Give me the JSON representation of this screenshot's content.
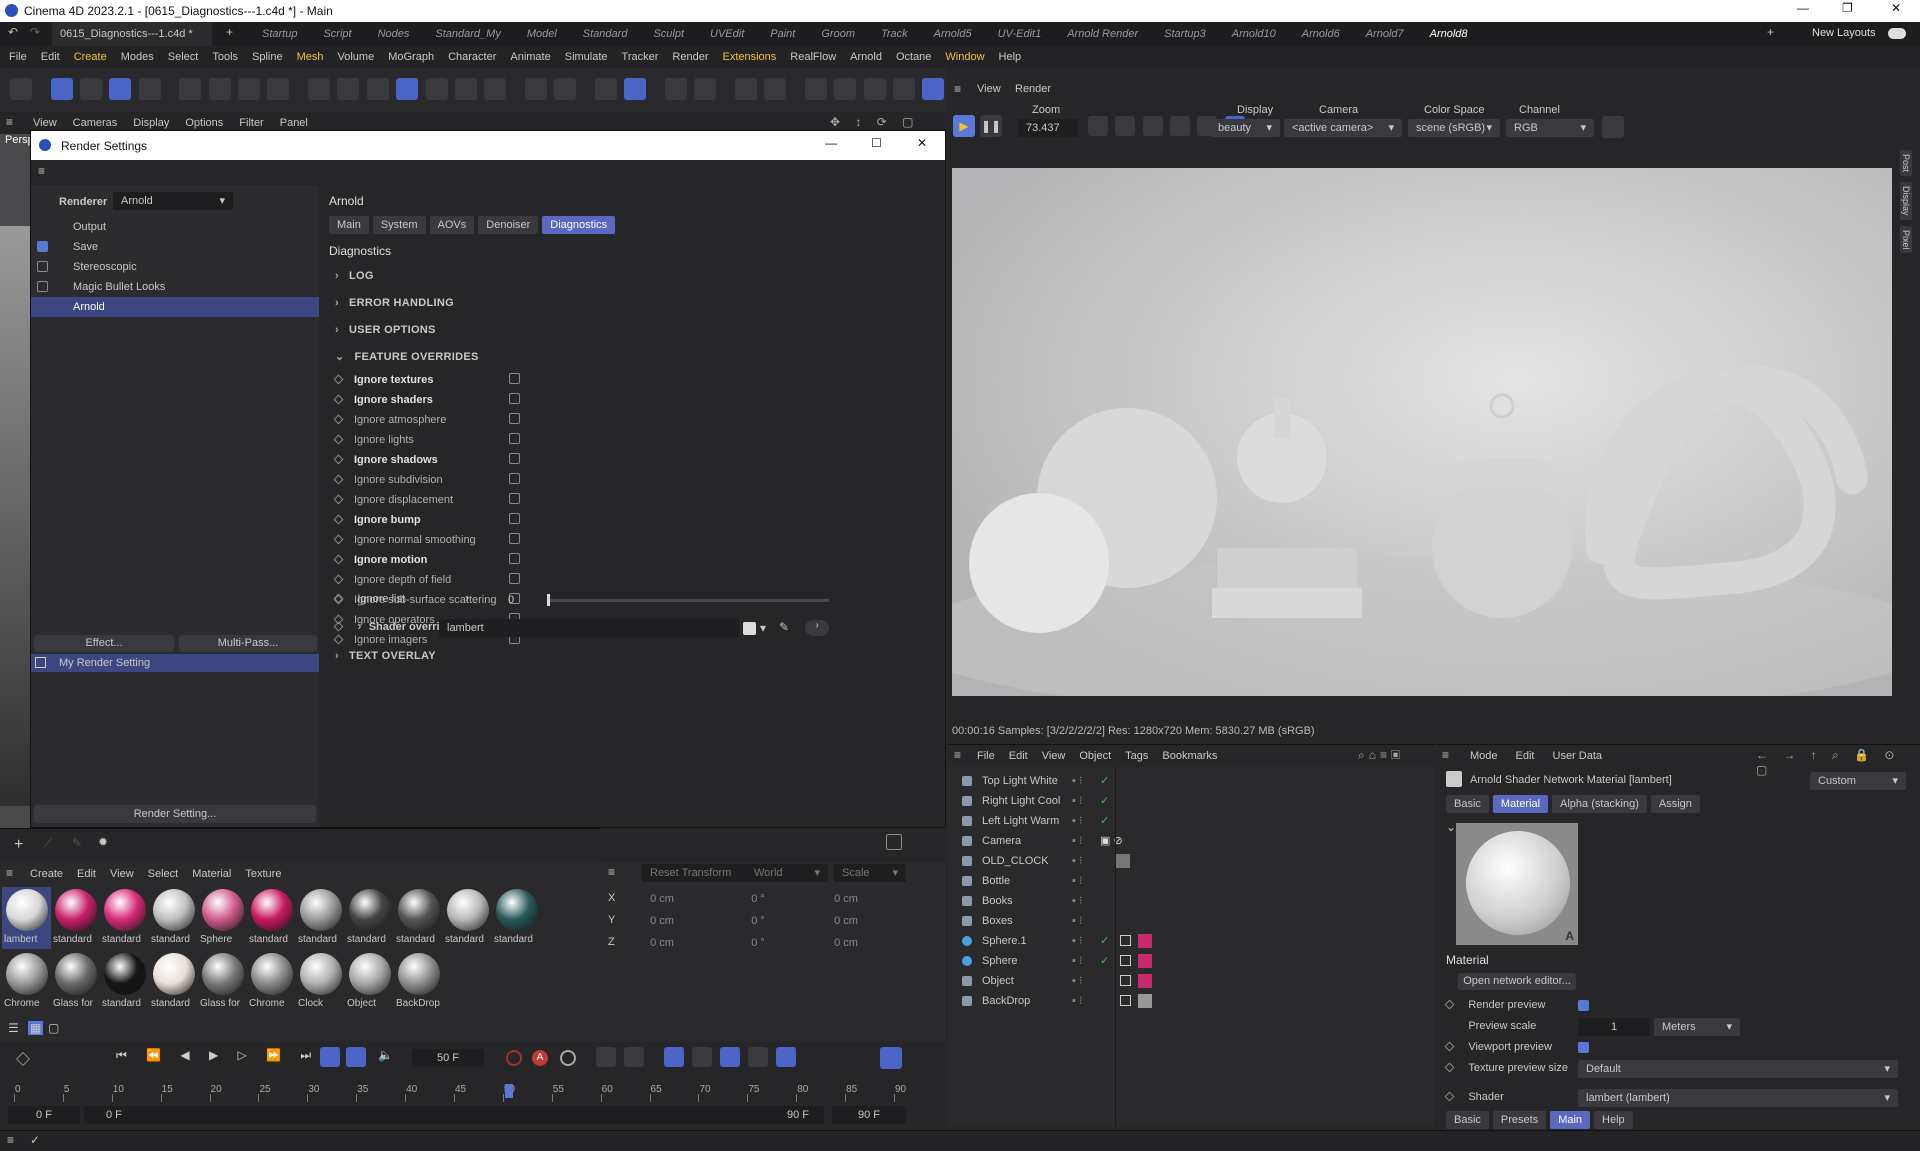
{
  "window": {
    "title": "Cinema 4D 2023.2.1 - [0615_Diagnostics---1.c4d *] - Main"
  },
  "doc_tab": "0615_Diagnostics---1.c4d *",
  "layouts": [
    "Startup",
    "Script",
    "Nodes",
    "Standard_My",
    "Model",
    "Standard",
    "Sculpt",
    "UVEdit",
    "Paint",
    "Groom",
    "Track",
    "Arnold5",
    "UV-Edit1",
    "Arnold Render",
    "Startup3",
    "Arnold10",
    "Arnold6",
    "Arnold7",
    "Arnold8"
  ],
  "new_layouts": "New Layouts",
  "menu": [
    "File",
    "Edit",
    "Create",
    "Modes",
    "Select",
    "Tools",
    "Spline",
    "Mesh",
    "Volume",
    "MoGraph",
    "Character",
    "Animate",
    "Simulate",
    "Tracker",
    "Render",
    "Extensions",
    "RealFlow",
    "Arnold",
    "Octane",
    "Window",
    "Help"
  ],
  "viewport_menu": [
    "View",
    "Cameras",
    "Display",
    "Options",
    "Filter",
    "Panel"
  ],
  "viewport_label": "Persp",
  "rs": {
    "title": "Render Settings",
    "renderer_label": "Renderer",
    "renderer_value": "Arnold",
    "left_items": [
      {
        "label": "Output",
        "check": ""
      },
      {
        "label": "Save",
        "check": "on"
      },
      {
        "label": "Stereoscopic",
        "check": "off"
      },
      {
        "label": "Magic Bullet Looks",
        "check": "off"
      },
      {
        "label": "Arnold",
        "check": ""
      }
    ],
    "effect": "Effect...",
    "multipass": "Multi-Pass...",
    "my_setting": "My Render Setting",
    "render_setting": "Render Setting...",
    "panel_title": "Arnold",
    "tabs": [
      "Main",
      "System",
      "AOVs",
      "Denoiser",
      "Diagnostics"
    ],
    "section_title": "Diagnostics",
    "sections": [
      "LOG",
      "ERROR HANDLING",
      "USER OPTIONS",
      "FEATURE OVERRIDES"
    ],
    "overrides": [
      {
        "label": "Ignore textures",
        "bold": true
      },
      {
        "label": "Ignore shaders",
        "bold": true
      },
      {
        "label": "Ignore atmosphere",
        "bold": false
      },
      {
        "label": "Ignore lights",
        "bold": false
      },
      {
        "label": "Ignore shadows",
        "bold": true
      },
      {
        "label": "Ignore subdivision",
        "bold": false
      },
      {
        "label": "Ignore displacement",
        "bold": false
      },
      {
        "label": "Ignore bump",
        "bold": true
      },
      {
        "label": "Ignore normal smoothing",
        "bold": false
      },
      {
        "label": "Ignore motion",
        "bold": true
      },
      {
        "label": "Ignore depth of field",
        "bold": false
      },
      {
        "label": "Ignore sub-surface scattering",
        "bold": false
      },
      {
        "label": "Ignore operators",
        "bold": false
      },
      {
        "label": "Ignore imagers",
        "bold": false
      }
    ],
    "ignore_list_label": "Ignore list",
    "ignore_list_value": "0",
    "shader_override_label": "Shader override*",
    "shader_override_value": "lambert",
    "text_overlay": "TEXT OVERLAY"
  },
  "render_view": {
    "menu": [
      "View",
      "Render"
    ],
    "zoom_label": "Zoom",
    "zoom_value": "73.437",
    "display_label": "Display",
    "display_value": "beauty",
    "camera_label": "Camera",
    "camera_value": "<active camera>",
    "colorspace_label": "Color Space",
    "colorspace_value": "scene (sRGB)",
    "channel_label": "Channel",
    "channel_value": "RGB",
    "status": "00:00:16  Samples: [3/2/2/2/2/2]  Res: 1280x720  Mem: 5830.27 MB  (sRGB)",
    "side_tabs": [
      "Post",
      "Display",
      "Pixel"
    ]
  },
  "obj_mgr": {
    "menu": [
      "File",
      "Edit",
      "View",
      "Object",
      "Tags",
      "Bookmarks"
    ],
    "items": [
      {
        "name": "Top Light White",
        "tag": "check"
      },
      {
        "name": "Right Light Cool",
        "tag": "check"
      },
      {
        "name": "Left Light Warm",
        "tag": "check"
      },
      {
        "name": "Camera",
        "tag": "cam"
      },
      {
        "name": "OLD_CLOCK",
        "tag": "mat"
      },
      {
        "name": "Bottle",
        "tag": ""
      },
      {
        "name": "Books",
        "tag": ""
      },
      {
        "name": "Boxes",
        "tag": ""
      },
      {
        "name": "Sphere.1",
        "tag": "pink"
      },
      {
        "name": "Sphere",
        "tag": "pink"
      },
      {
        "name": "Object",
        "tag": "pink2"
      },
      {
        "name": "BackDrop",
        "tag": "grey"
      }
    ]
  },
  "attr": {
    "menu": [
      "Mode",
      "Edit",
      "User Data"
    ],
    "title": "Arnold Shader Network Material [lambert]",
    "preset": "Custom",
    "tabs": [
      "Basic",
      "Material",
      "Alpha (stacking)",
      "Assign"
    ],
    "section": "Material",
    "open_editor": "Open network editor...",
    "render_preview": "Render preview",
    "preview_scale": "Preview scale",
    "preview_scale_value": "1",
    "preview_scale_unit": "Meters",
    "viewport_preview": "Viewport preview",
    "texture_preview_size": "Texture preview size",
    "texture_preview_value": "Default",
    "shader_label": "Shader",
    "shader_value": "lambert (lambert)",
    "bottom_tabs": [
      "Basic",
      "Presets",
      "Main",
      "Help"
    ]
  },
  "materials": {
    "menu": [
      "Create",
      "Edit",
      "View",
      "Select",
      "Material",
      "Texture"
    ],
    "row1": [
      {
        "name": "lambert",
        "color": "#d8d8d8"
      },
      {
        "name": "standard",
        "color": "#c8206a"
      },
      {
        "name": "standard",
        "color": "#d82a78"
      },
      {
        "name": "standard",
        "color": "#c0c0c0"
      },
      {
        "name": "Sphere",
        "color": "#d05a8a"
      },
      {
        "name": "standard",
        "color": "#c81a60"
      },
      {
        "name": "standard",
        "color": "#9a9a9a"
      },
      {
        "name": "standard",
        "color": "#444444"
      },
      {
        "name": "standard",
        "color": "#555555"
      },
      {
        "name": "standard",
        "color": "#b8b8b8"
      },
      {
        "name": "standard",
        "color": "#2a5a5a"
      }
    ],
    "row2": [
      {
        "name": "Chrome",
        "color": "#9a9a9a"
      },
      {
        "name": "Glass for",
        "color": "#6a6a6a"
      },
      {
        "name": "standard",
        "color": "#151515"
      },
      {
        "name": "standard",
        "color": "#e8e0d8"
      },
      {
        "name": "Glass for",
        "color": "#7a7a7a"
      },
      {
        "name": "Chrome",
        "color": "#8a8a8a"
      },
      {
        "name": "Clock",
        "color": "#b0b0b0"
      },
      {
        "name": "Object",
        "color": "#a8a8a8"
      },
      {
        "name": "BackDrop",
        "color": "#909090"
      }
    ]
  },
  "coords": {
    "reset": "Reset Transform",
    "world": "World",
    "scale": "Scale",
    "rows": [
      {
        "axis": "X",
        "a": "0 cm",
        "b": "0 °",
        "c": "0 cm"
      },
      {
        "axis": "Y",
        "a": "0 cm",
        "b": "0 °",
        "c": "0 cm"
      },
      {
        "axis": "Z",
        "a": "0 cm",
        "b": "0 °",
        "c": "0 cm"
      }
    ]
  },
  "timeline": {
    "frame": "50 F",
    "ticks": [
      "0",
      "5",
      "10",
      "15",
      "20",
      "25",
      "30",
      "35",
      "40",
      "45",
      "50",
      "55",
      "60",
      "65",
      "70",
      "75",
      "80",
      "85",
      "90"
    ],
    "start_a": "0 F",
    "start_b": "0 F",
    "end_a": "90 F",
    "end_b": "90 F"
  }
}
